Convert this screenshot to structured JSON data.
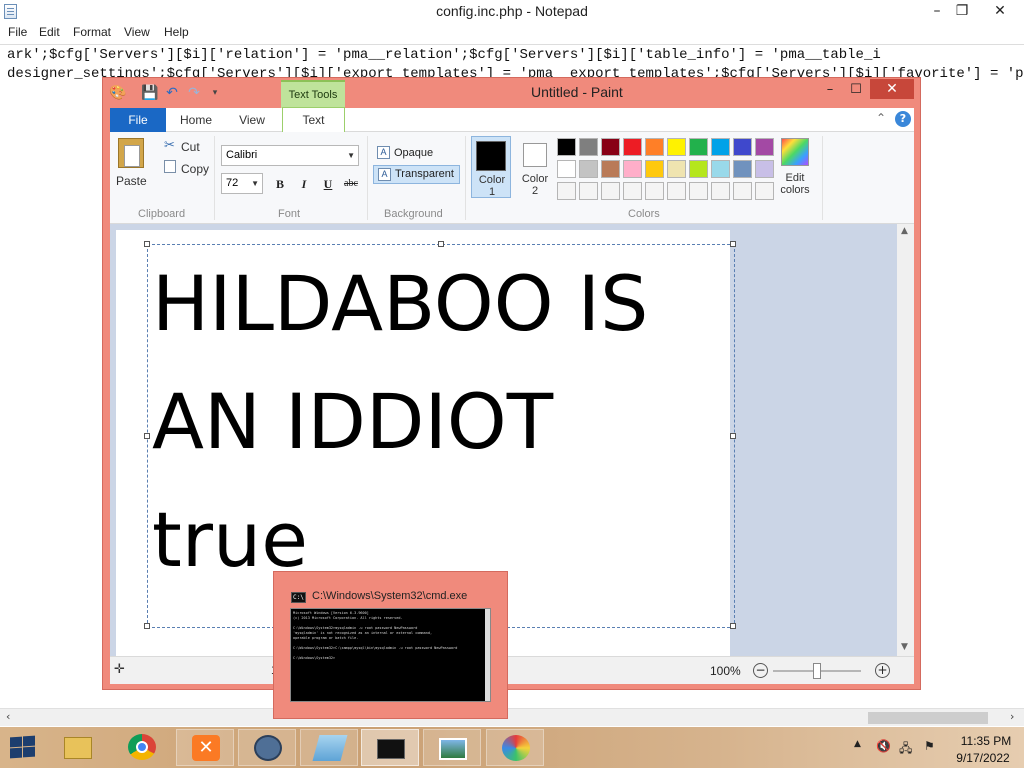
{
  "notepad": {
    "title": "config.inc.php - Notepad",
    "window_controls": [
      "–",
      "❐",
      "✕"
    ],
    "menu": [
      "File",
      "Edit",
      "Format",
      "View",
      "Help"
    ],
    "lines": [
      "ark';$cfg['Servers'][$i]['relation'] = 'pma__relation';$cfg['Servers'][$i]['table_info'] = 'pma__table_i",
      "designer_settings';$cfg['Servers'][$i]['export_templates'] = 'pma__export_templates';$cfg['Servers'][$i]['favorite'] = 'pma_"
    ],
    "scroll_left": "‹",
    "scroll_right": "›"
  },
  "paint": {
    "title": "Untitled - Paint",
    "contextual_tab_group": "Text Tools",
    "window_controls": [
      "–",
      "☐",
      "✕"
    ],
    "tabs": {
      "file": "File",
      "home": "Home",
      "view": "View",
      "text": "Text"
    },
    "clipboard": {
      "paste": "Paste",
      "cut": "Cut",
      "copy": "Copy",
      "group_label": "Clipboard"
    },
    "font": {
      "family": "Calibri",
      "size": "72",
      "bold": "B",
      "italic": "I",
      "underline": "U",
      "strikethrough": "abc",
      "group_label": "Font"
    },
    "background": {
      "opaque": "Opaque",
      "transparent": "Transparent",
      "group_label": "Background"
    },
    "colors": {
      "color1_label": "Color 1",
      "color2_label": "Color 2",
      "edit_colors_label": "Edit colors",
      "group_label": "Colors",
      "color1_value": "#000000",
      "color2_value": "#ffffff",
      "palette": [
        [
          "#000000",
          "#7f7f7f",
          "#880015",
          "#ed1c24",
          "#ff7f27",
          "#fff200",
          "#22b14c",
          "#00a2e8",
          "#3f48cc",
          "#a349a4"
        ],
        [
          "#ffffff",
          "#c3c3c3",
          "#b97a57",
          "#ffaec9",
          "#ffc90e",
          "#efe4b0",
          "#b5e61d",
          "#99d9ea",
          "#7092be",
          "#c8bfe7"
        ],
        [
          "#f4f4f4",
          "#f4f4f4",
          "#f4f4f4",
          "#f4f4f4",
          "#f4f4f4",
          "#f4f4f4",
          "#f4f4f4",
          "#f4f4f4",
          "#f4f4f4",
          "#f4f4f4"
        ]
      ]
    },
    "canvas_text": [
      "HILDABOO IS",
      "AN IDDIOT",
      "true"
    ],
    "status": {
      "cursor_value": "1",
      "zoom": "100%",
      "zoom_out": "−",
      "zoom_in": "+",
      "zoom_level": 0.5
    }
  },
  "cmd_thumbnail": {
    "title": "C:\\Windows\\System32\\cmd.exe",
    "icon_text": "C:\\",
    "lines": [
      "Microsoft Windows [Version 6.3.9600]",
      "(c) 2013 Microsoft Corporation. All rights reserved.",
      "",
      "C:\\Windows\\System32>mysqladmin -u root password NewPassword",
      "'mysqladmin' is not recognized as an internal or external command,",
      "operable program or batch file.",
      "",
      "C:\\Windows\\System32>C:\\xampp\\mysql\\bin\\mysqladmin -u root password NewPassword",
      "",
      "C:\\Windows\\System32>"
    ]
  },
  "taskbar": {
    "items": [
      {
        "name": "file-explorer",
        "state": "none"
      },
      {
        "name": "chrome",
        "state": "none"
      },
      {
        "name": "xampp",
        "state": "running"
      },
      {
        "name": "app-circle",
        "state": "running"
      },
      {
        "name": "notepad",
        "state": "running"
      },
      {
        "name": "cmd",
        "state": "active"
      },
      {
        "name": "photos",
        "state": "running"
      },
      {
        "name": "paint",
        "state": "running"
      }
    ],
    "time": "11:35 PM",
    "date": "9/17/2022"
  }
}
